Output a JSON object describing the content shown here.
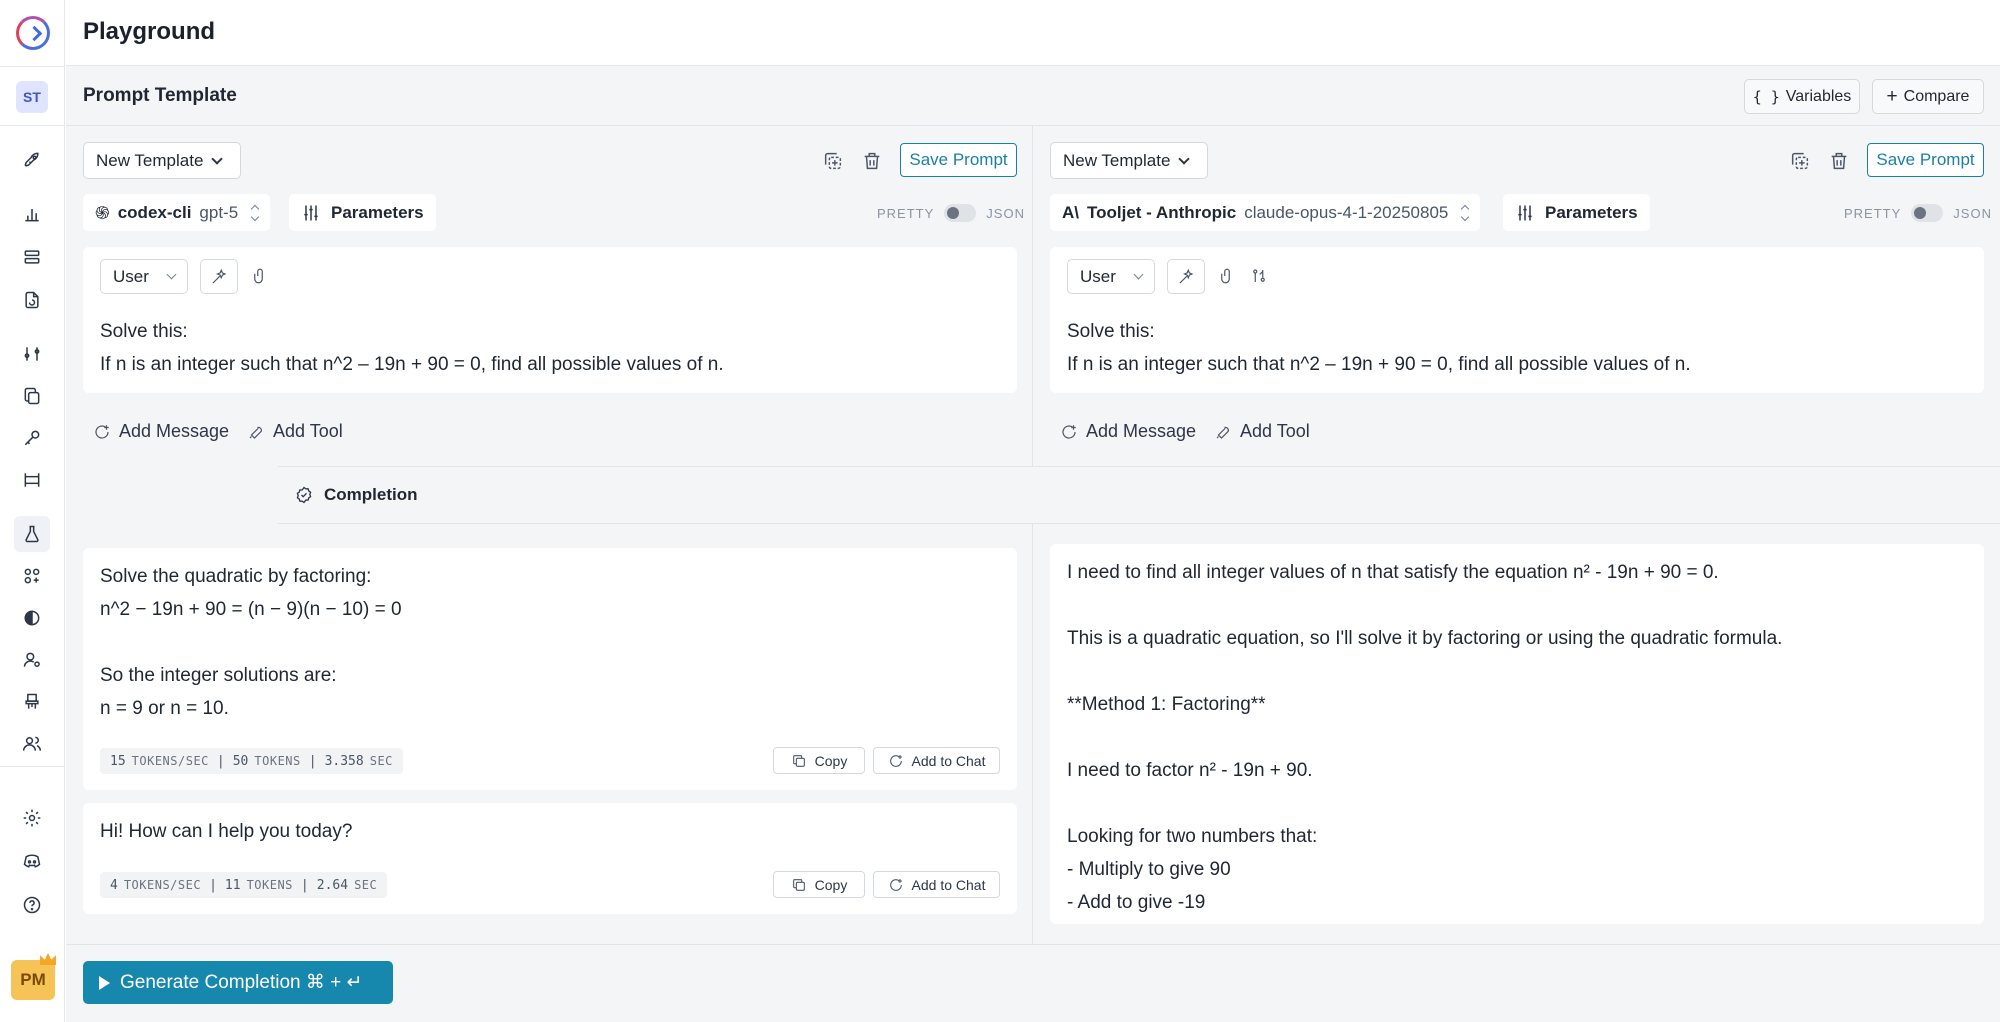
{
  "app": {
    "title": "Playground"
  },
  "sidebar": {
    "workspace_initials": "ST",
    "user_initials": "PM"
  },
  "header": {
    "section_title": "Prompt Template",
    "variables_label": "Variables",
    "compare_label": "Compare"
  },
  "panels": [
    {
      "template_label": "New Template",
      "save_label": "Save Prompt",
      "provider": "codex-cli",
      "model": "gpt-5",
      "parameters_label": "Parameters",
      "pretty_label": "PRETTY",
      "json_label": "JSON",
      "message": {
        "role": "User",
        "line1": "Solve this:",
        "line2": "If n is an integer such that n^2 – 19n + 90 = 0, find all possible values of n."
      },
      "add_message_label": "Add Message",
      "add_tool_label": "Add Tool"
    },
    {
      "template_label": "New Template",
      "save_label": "Save Prompt",
      "provider": "Tooljet - Anthropic",
      "model": "claude-opus-4-1-20250805",
      "parameters_label": "Parameters",
      "pretty_label": "PRETTY",
      "json_label": "JSON",
      "message": {
        "role": "User",
        "line1": "Solve this:",
        "line2": "If n is an integer such that n^2 – 19n + 90 = 0, find all possible values of n."
      },
      "add_message_label": "Add Message",
      "add_tool_label": "Add Tool"
    }
  ],
  "completion": {
    "label": "Completion",
    "left": [
      {
        "text": "Solve the quadratic by factoring:\nn^2 − 19n + 90 = (n − 9)(n − 10) = 0\n\nSo the integer solutions are:\nn = 9 or n = 10.",
        "tps": "15",
        "tps_unit": "TOKENS/SEC",
        "tokens": "50",
        "tokens_unit": "TOKENS",
        "secs": "3.358",
        "secs_unit": "SEC",
        "copy_label": "Copy",
        "add_chat_label": "Add to Chat"
      },
      {
        "text": "Hi! How can I help you today?",
        "tps": "4",
        "tps_unit": "TOKENS/SEC",
        "tokens": "11",
        "tokens_unit": "TOKENS",
        "secs": "2.64",
        "secs_unit": "SEC",
        "copy_label": "Copy",
        "add_chat_label": "Add to Chat"
      }
    ],
    "right": {
      "text": "I need to find all integer values of n that satisfy the equation n² - 19n + 90 = 0.\n\nThis is a quadratic equation, so I'll solve it by factoring or using the quadratic formula.\n\n**Method 1: Factoring**\n\nI need to factor n² - 19n + 90.\n\nLooking for two numbers that:\n- Multiply to give 90\n- Add to give -19"
    }
  },
  "footer": {
    "generate_label": "Generate Completion ⌘ + ↵"
  }
}
